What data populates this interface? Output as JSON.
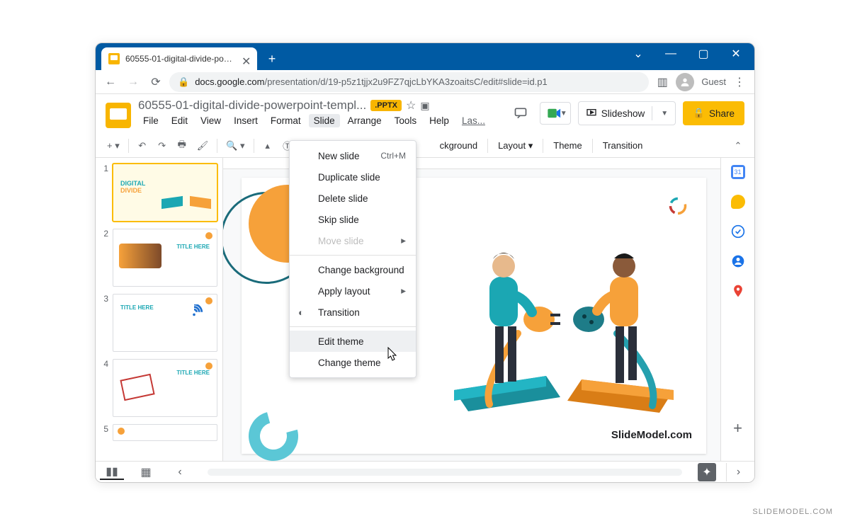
{
  "browser": {
    "tab_title": "60555-01-digital-divide-powerpc",
    "url_host": "docs.google.com",
    "url_path": "/presentation/d/19-p5z1tjjx2u9FZ7qjcLbYKA3zoaitsC/edit#slide=id.p1",
    "guest_label": "Guest"
  },
  "doc": {
    "title": "60555-01-digital-divide-powerpoint-templ...",
    "badge": ".PPTX",
    "menus": [
      "File",
      "Edit",
      "View",
      "Insert",
      "Format",
      "Slide",
      "Arrange",
      "Tools",
      "Help",
      "Las..."
    ],
    "open_menu_index": 5
  },
  "header_buttons": {
    "slideshow": "Slideshow",
    "share": "Share"
  },
  "toolbar": {
    "background": "ckground",
    "layout": "Layout",
    "theme": "Theme",
    "transition": "Transition"
  },
  "dropdown": {
    "items": [
      {
        "label": "New slide",
        "shortcut": "Ctrl+M"
      },
      {
        "label": "Duplicate slide"
      },
      {
        "label": "Delete slide"
      },
      {
        "label": "Skip slide"
      },
      {
        "label": "Move slide",
        "submenu": true,
        "disabled": true
      },
      {
        "sep": true
      },
      {
        "label": "Change background"
      },
      {
        "label": "Apply layout",
        "submenu": true
      },
      {
        "label": "Transition",
        "icon": "transition"
      },
      {
        "sep": true
      },
      {
        "label": "Edit theme",
        "hover": true
      },
      {
        "label": "Change theme"
      }
    ]
  },
  "thumbs": {
    "numbers": [
      "1",
      "2",
      "3",
      "4",
      "5"
    ],
    "t2_title": "TITLE HERE",
    "t3_title": "TITLE HERE",
    "t4_title": "TITLE HERE",
    "dd_title": "DIGITAL",
    "dd_title2": "DIVIDE"
  },
  "slide": {
    "brand": "SlideModel.com"
  },
  "footer_watermark": "SLIDEMODEL.COM"
}
